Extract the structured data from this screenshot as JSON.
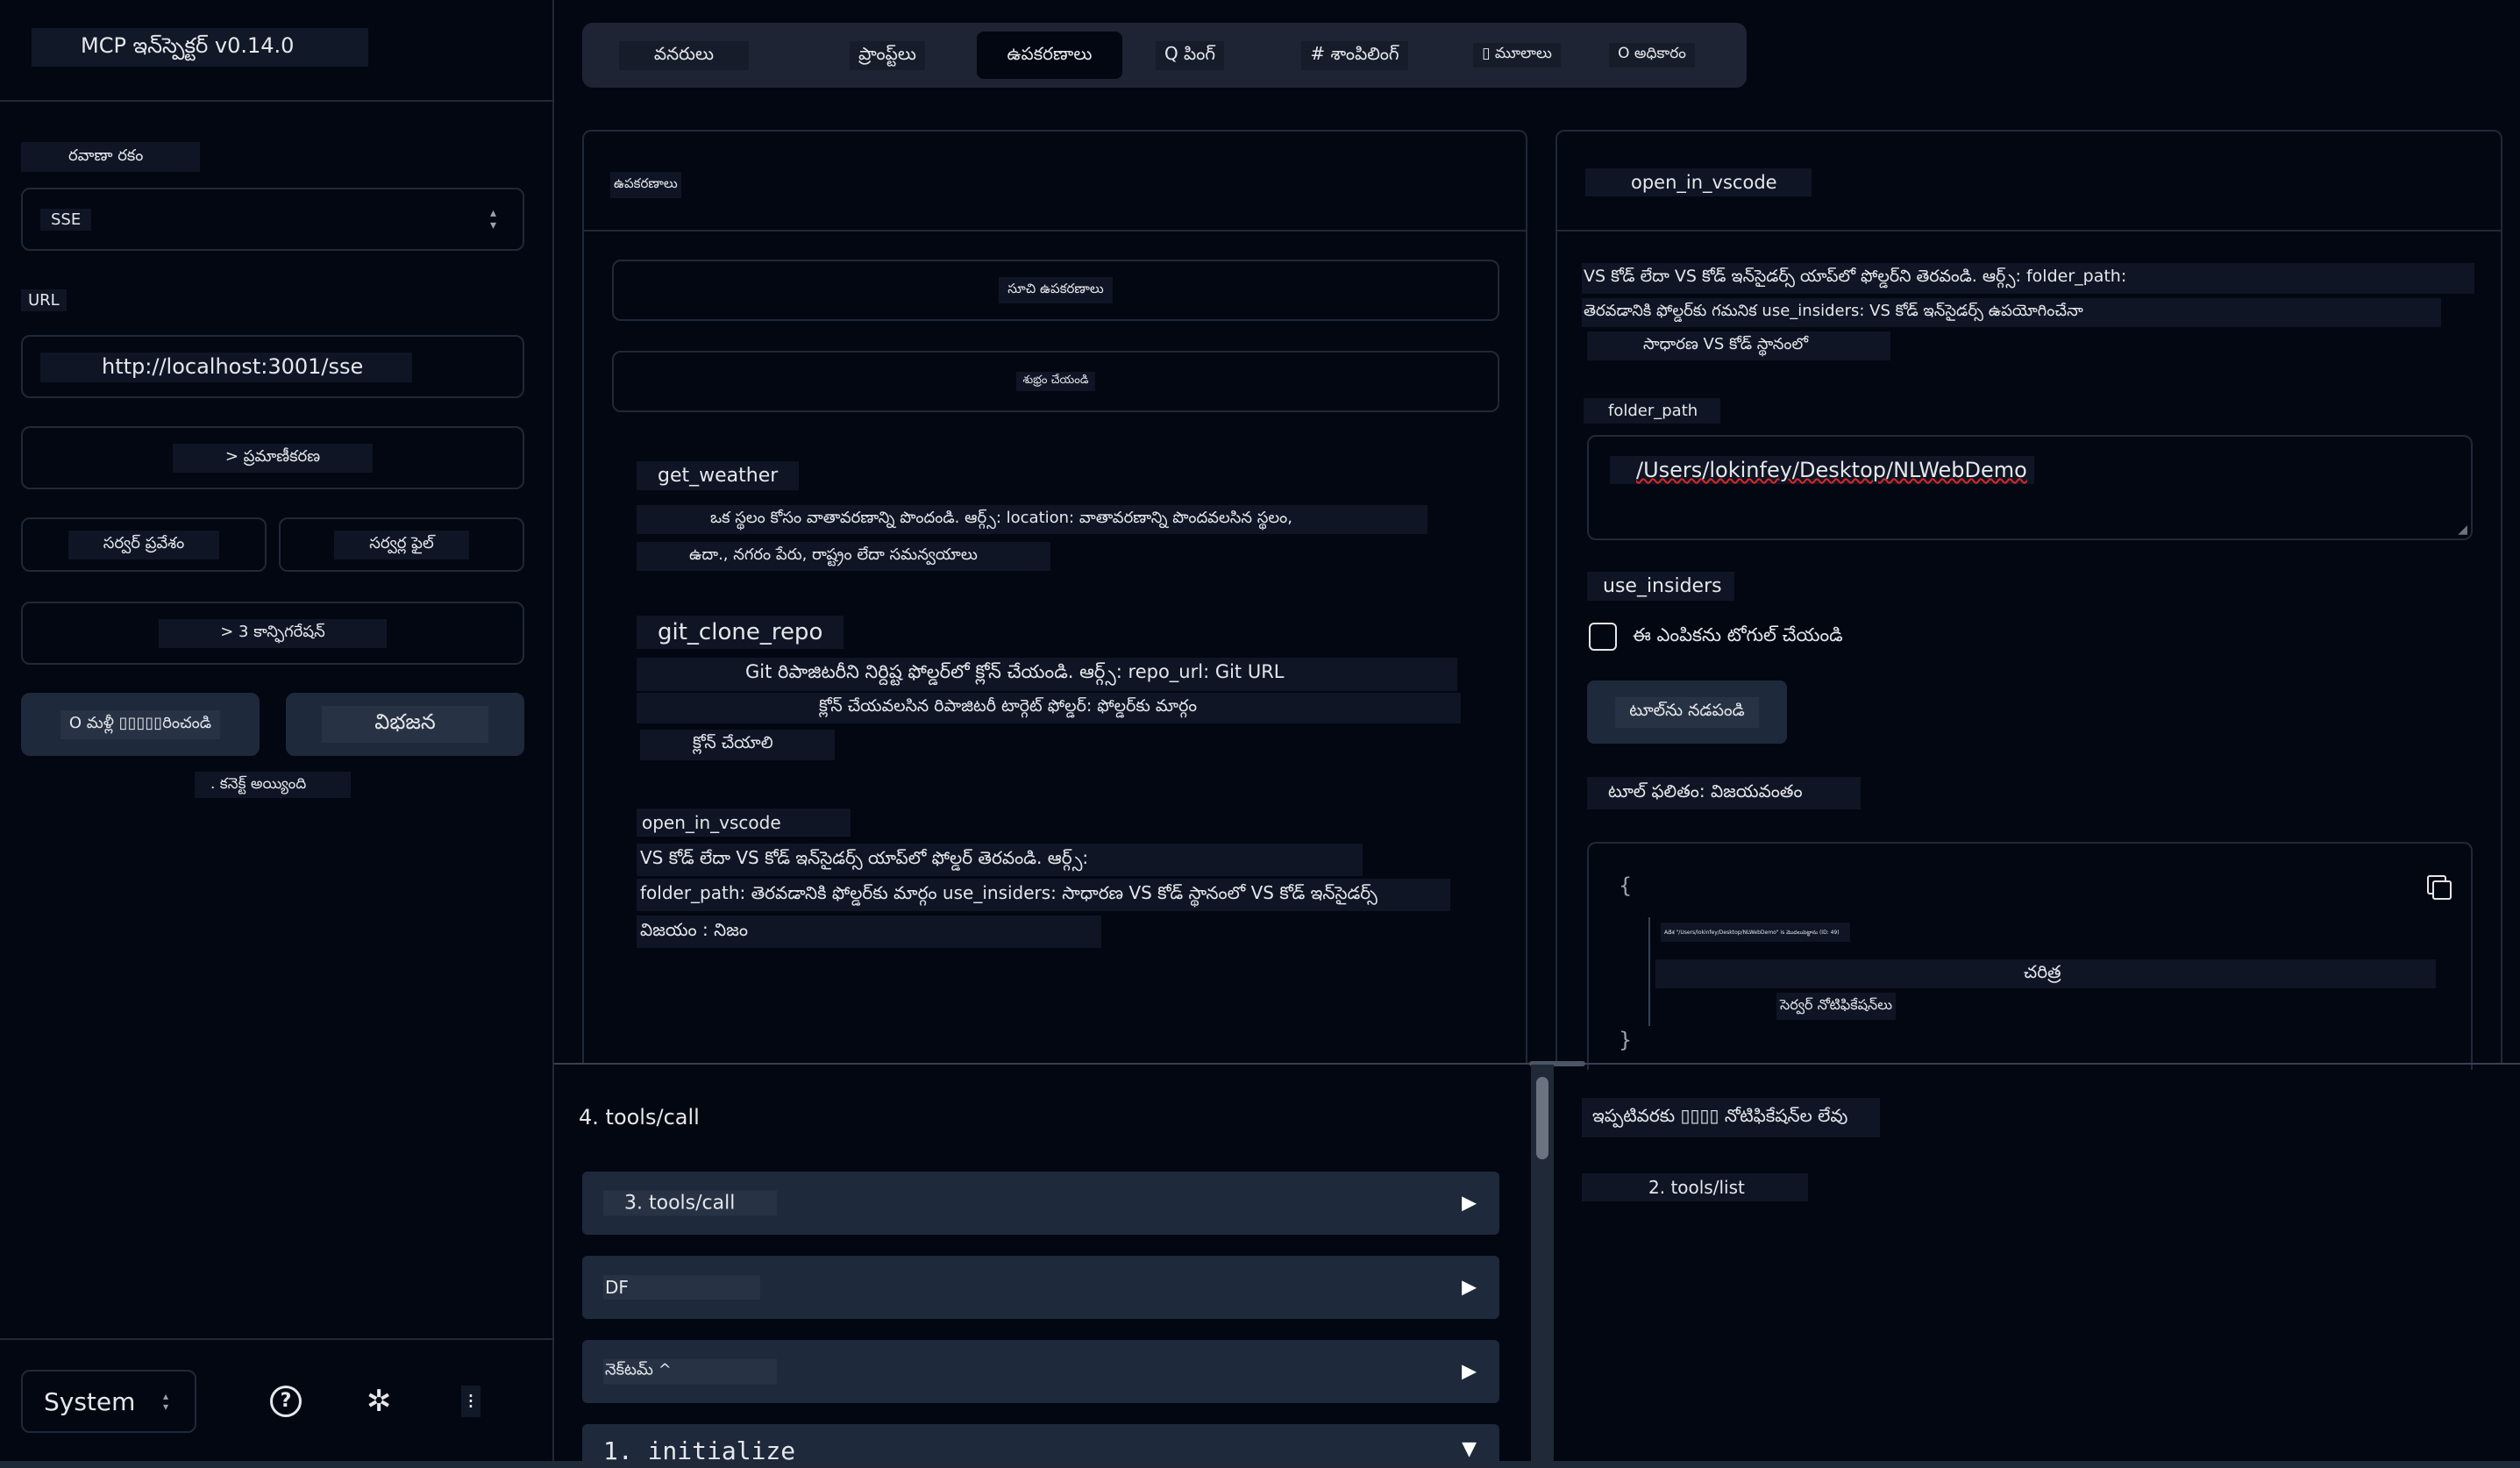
{
  "app": {
    "title": "MCP ఇన్‌స్పెక్టర్ v0.14.0"
  },
  "sidebar": {
    "transport_label": "రవాణా రకం",
    "transport_value": "SSE",
    "url_label": "URL",
    "url_value": "http://localhost:3001/sse",
    "auth_label": "> ప్రమాణీకరణ",
    "server_entry_label": "సర్వర్ ప్రవేశం",
    "server_file_label": "సర్వర్ల ఫైల్",
    "config_label": "> 3 కాన్ఫిగరేషన్",
    "reconnect_label": "O మళ్లీ ▯▯▯▯▯రించండి",
    "disconnect_label": "విభజన",
    "status_label": ". కనెక్ట్ అయ్యింది",
    "theme_value": "System"
  },
  "tabs": [
    {
      "label": "వనరులు"
    },
    {
      "label": "ప్రాంప్ట్‌లు"
    },
    {
      "label": "ఉపకరణాలు"
    },
    {
      "label": "Q పింగ్"
    },
    {
      "label": "# శాంపిలింగ్"
    },
    {
      "label": "▯ మూలాలు"
    },
    {
      "label": "O అధికారం"
    }
  ],
  "tools_panel": {
    "title": "ఉపకరణాలు",
    "list_button": "సూచి ఉపకరణాలు",
    "clear_button": "శుభ్రం చేయండి",
    "tools": [
      {
        "name": "get_weather",
        "desc_lines": [
          "ఒక స్థలం కోసం వాతావరణాన్ని పొందండి. ఆర్గ్స్: location: వాతావరణాన్ని పొందవలసిన స్థలం,",
          "ఉదా., నగరం పేరు, రాష్ట్రం లేదా సమన్వయాలు"
        ]
      },
      {
        "name": "git_clone_repo",
        "desc_lines": [
          "Git రిపాజిటరీని నిర్దిష్ట ఫోల్డర్‌లో క్లోన్ చేయండి. ఆర్గ్స్: repo_url: Git URL",
          "క్లోన్ చేయవలసిన రిపాజిటరీ టార్గెట్ ఫోల్డర్: ఫోల్డర్‌కు మార్గం",
          "క్లోన్ చేయాలి"
        ]
      },
      {
        "name": "open_in_vscode",
        "desc_lines": [
          "VS కోడ్ లేదా VS కోడ్ ఇన్‌సైడర్స్ యాప్‌లో ఫోల్డర్ తెరవండి. ఆర్గ్స్:",
          "folder_path: తెరవడానికి ఫోల్డర్‌కు మార్గం use_insiders: సాధారణ VS కోడ్ స్థానంలో VS కోడ్ ఇన్‌సైడర్స్",
          "విజయం : నిజం"
        ]
      }
    ]
  },
  "detail_panel": {
    "title": "open_in_vscode",
    "desc_lines": [
      "VS కోడ్ లేదా VS కోడ్ ఇన్‌సైడర్స్ యాప్‌లో ఫోల్డర్‌ని తెరవండి. ఆర్గ్స్: folder_path:",
      "తెరవడానికి ఫోల్డర్‌కు గమనిక use_insiders: VS కోడ్ ఇన్‌సైడర్స్ ఉపయోగించేనా",
      "సాధారణ VS కోడ్ స్థానంలో"
    ],
    "folder_path_label": "folder_path",
    "folder_path_value": "/Users/lokinfey/Desktop/NLWebDemo",
    "use_insiders_label": "use_insiders",
    "toggle_label": "ఈ ఎంపికను టోగుల్ చేయండి",
    "run_button": "టూల్‌ను నడపండి",
    "result_label": "టూల్ ఫలితం: విజయవంతం",
    "result_open": "{",
    "result_line": "Aదేశ \"/Users/lokinfey/Desktop/NLWebDemo\" is మొదలుపెట్టాను (ID: 49)",
    "history_label": "చరిత్ర",
    "server_notifications": "సెర్వర్ నోటిఫికేషన్‌లు",
    "result_close": "}"
  },
  "history": {
    "header": "4. tools/call",
    "items": [
      {
        "label": "3. tools/call",
        "arrow": "▶"
      },
      {
        "label": "DF",
        "arrow": "▶"
      },
      {
        "label": "నెక్‌టమ్ ^",
        "arrow": "▶"
      },
      {
        "label": "1. initialize",
        "arrow": "▼"
      }
    ]
  },
  "notifications": {
    "empty_label": "ఇప్పటివరకు ▯▯▯▯ నోటిఫికేషన్‌ల లేవు",
    "item": "2. tools/list"
  }
}
